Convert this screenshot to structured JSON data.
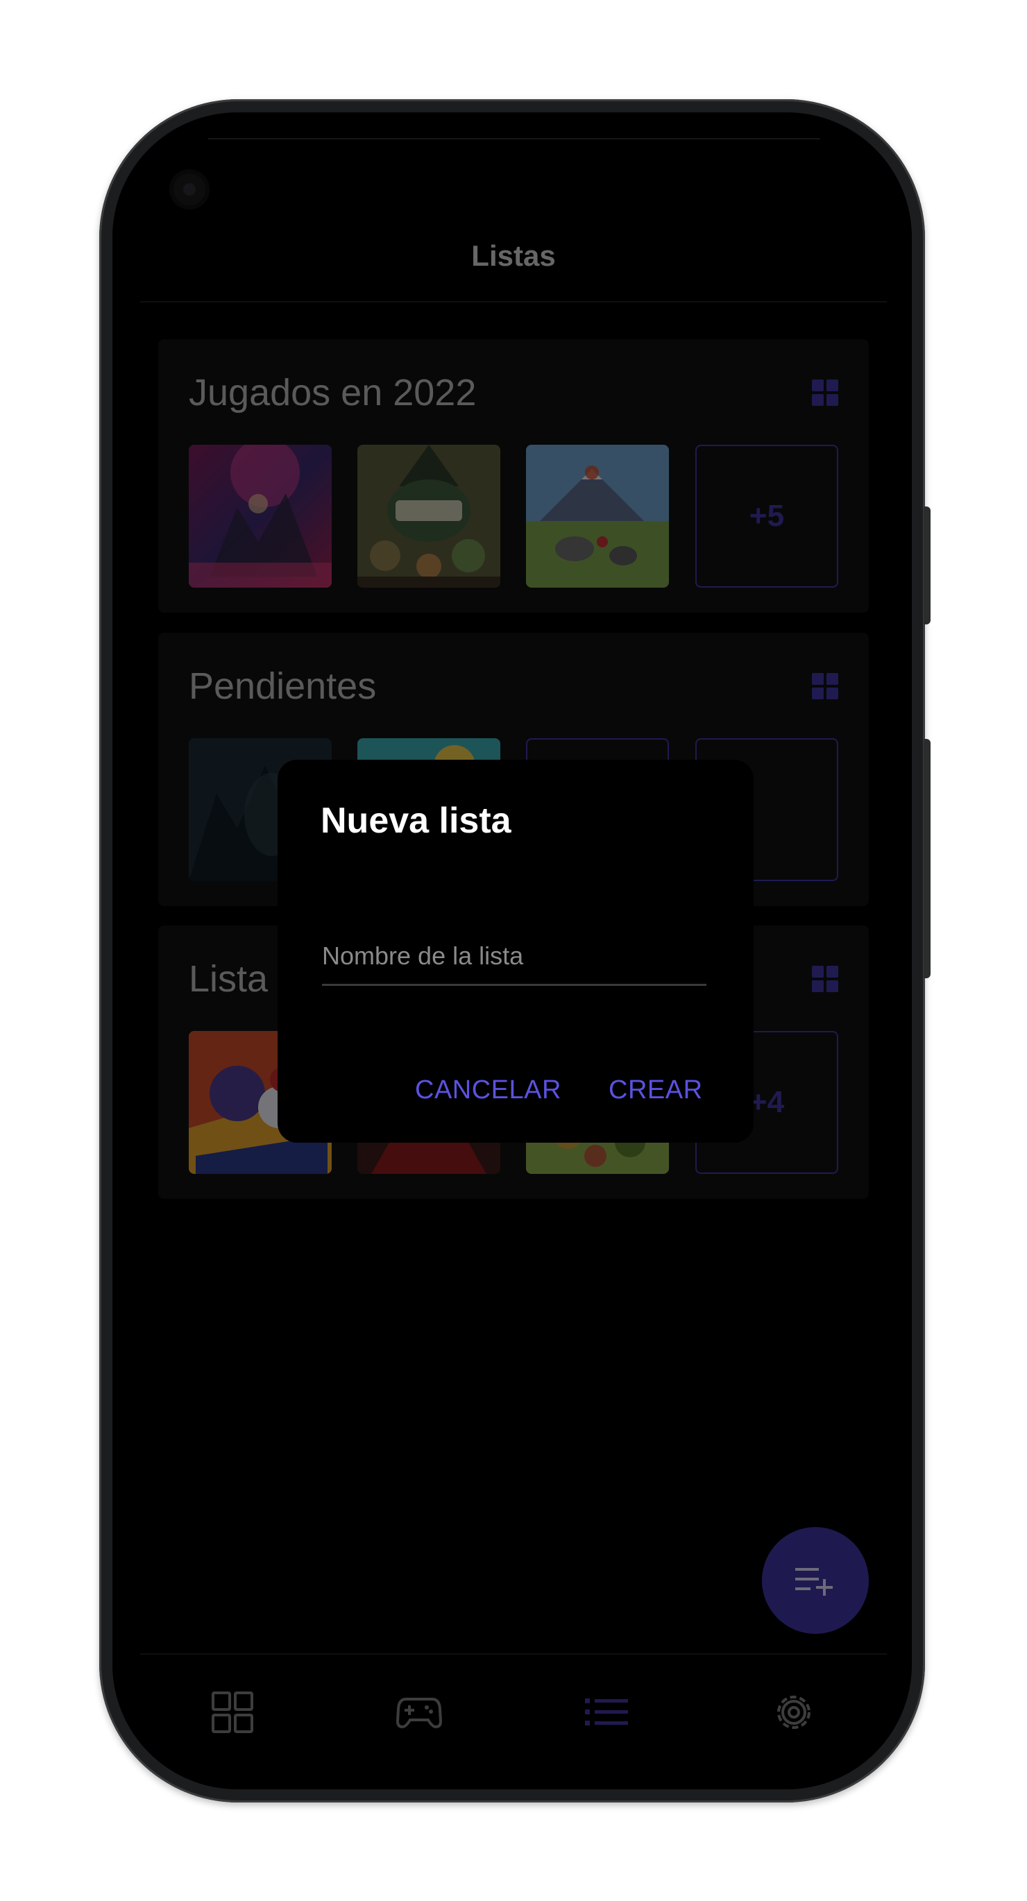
{
  "app": {
    "title": "Listas"
  },
  "lists": [
    {
      "title": "Jugados en 2022",
      "more_label": "+5"
    },
    {
      "title": "Pendientes"
    },
    {
      "title": "Lista",
      "more_label": "+4"
    }
  ],
  "icons": {
    "grid": "grid-view-icon",
    "fab": "playlist-add-icon",
    "nav": [
      "dashboard-icon",
      "gamepad-icon",
      "list-icon",
      "settings-icon"
    ]
  },
  "nav": {
    "active_index": 2
  },
  "dialog": {
    "title": "Nueva lista",
    "input_placeholder": "Nombre de la lista",
    "input_value": "",
    "cancel_label": "CANCELAR",
    "confirm_label": "CREAR"
  },
  "colors": {
    "accent": "#3d35a1",
    "accent_text": "#5b52e0",
    "card": "#111112",
    "background": "#000000"
  }
}
